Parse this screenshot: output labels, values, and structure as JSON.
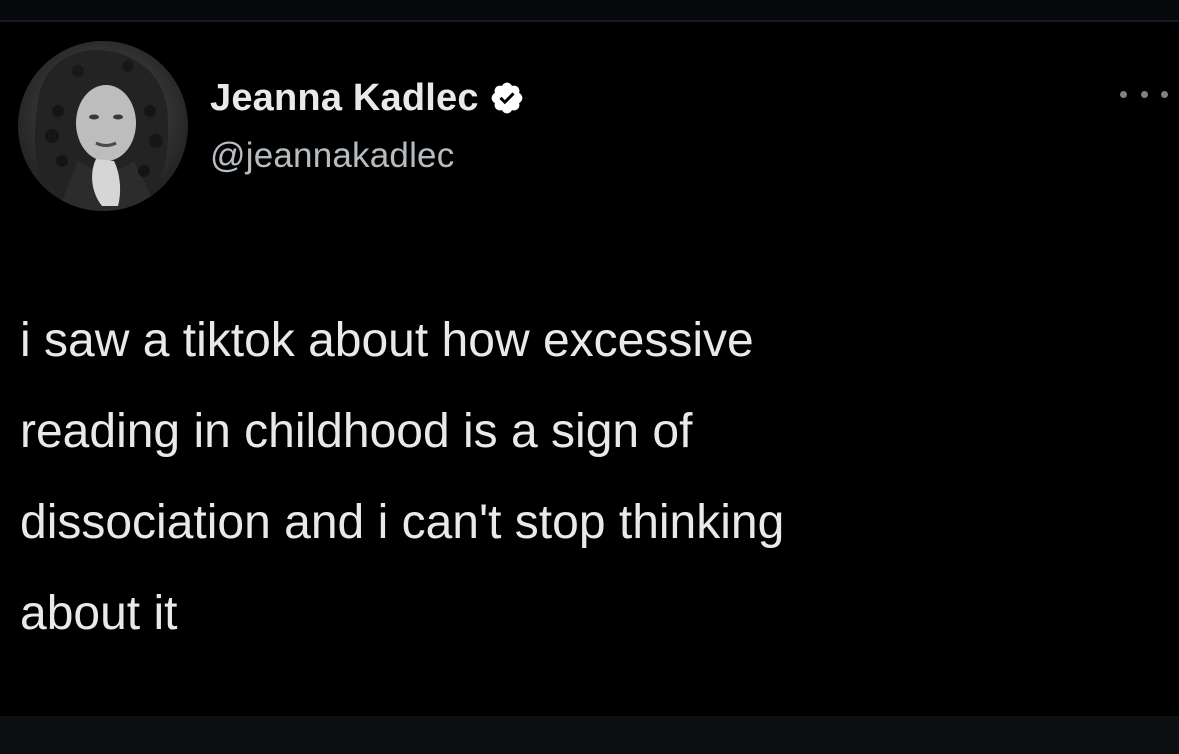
{
  "tweet": {
    "author": {
      "display_name": "Jeanna Kadlec",
      "handle": "@jeannakadlec",
      "verified": true,
      "avatar_icon": "profile-photo"
    },
    "more_icon": "more-horizontal-icon",
    "text": "i saw a tiktok about how excessive\nreading in childhood is a sign of\ndissociation and i can't stop thinking\nabout it"
  },
  "theme": {
    "background": "#000000",
    "text_primary": "#e7e9ea",
    "text_secondary": "#b7bcc1",
    "badge_color": "#ffffff"
  }
}
